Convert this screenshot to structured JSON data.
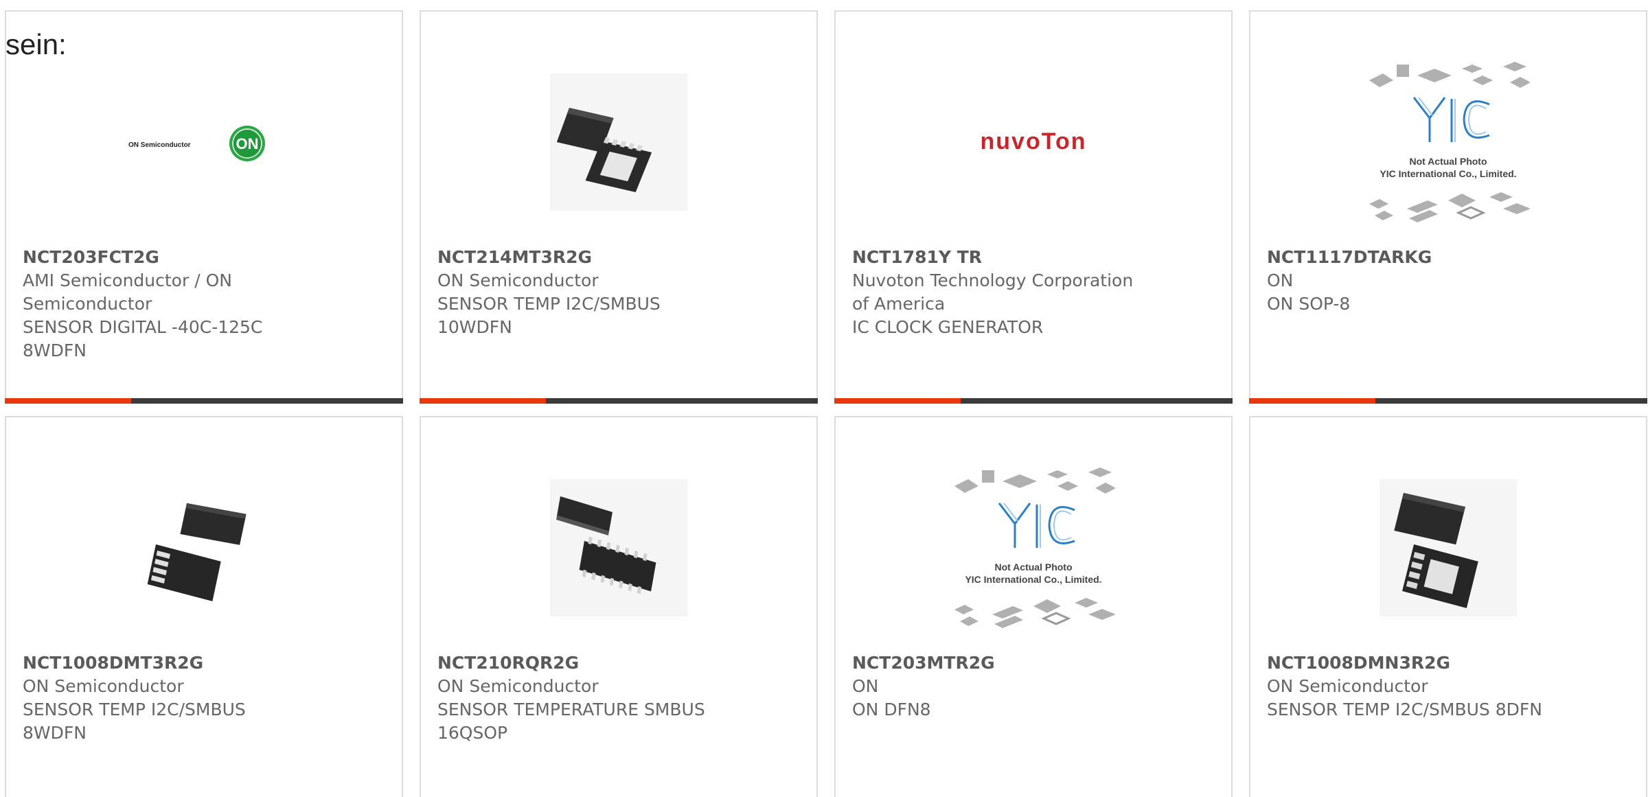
{
  "header": {
    "text": "sein:"
  },
  "colors": {
    "accent": "#e8380d",
    "bar": "#3b3b3b",
    "border": "#dddddd",
    "text": "#666666"
  },
  "products": [
    {
      "part": "NCT203FCT2G",
      "manufacturer": "AMI Semiconductor / ON Semiconductor",
      "description": "SENSOR DIGITAL -40C-125C 8WDFN",
      "image": "on-semiconductor-logo",
      "image_text": "ON Semiconductor",
      "logo_mark": "ON"
    },
    {
      "part": "NCT214MT3R2G",
      "manufacturer": "ON Semiconductor",
      "description": "SENSOR TEMP I2C/SMBUS 10WDFN",
      "image": "wdfn-chip-photo"
    },
    {
      "part": "NCT1781Y TR",
      "manufacturer": "Nuvoton Technology Corporation of America",
      "description": "IC CLOCK GENERATOR",
      "image": "nuvoton-logo",
      "image_text": "nuvoTon"
    },
    {
      "part": "NCT1117DTARKG",
      "manufacturer": "ON",
      "description": "ON SOP-8",
      "image": "yic-placeholder",
      "logo_mark": "YIC",
      "image_text": "Not Actual Photo",
      "image_text2": "YIC International Co., Limited."
    },
    {
      "part": "NCT1008DMT3R2G",
      "manufacturer": "ON Semiconductor",
      "description": "SENSOR TEMP I2C/SMBUS 8WDFN",
      "image": "wdfn8-chip-photo"
    },
    {
      "part": "NCT210RQR2G",
      "manufacturer": "ON Semiconductor",
      "description": "SENSOR TEMPERATURE SMBUS 16QSOP",
      "image": "qsop-chip-photo"
    },
    {
      "part": "NCT203MTR2G",
      "manufacturer": "ON",
      "description": "ON DFN8",
      "image": "yic-placeholder",
      "logo_mark": "YIC",
      "image_text": "Not Actual Photo",
      "image_text2": "YIC International Co., Limited."
    },
    {
      "part": "NCT1008DMN3R2G",
      "manufacturer": "ON Semiconductor",
      "description": "SENSOR TEMP I2C/SMBUS 8DFN",
      "image": "dfn-chip-photo"
    }
  ]
}
